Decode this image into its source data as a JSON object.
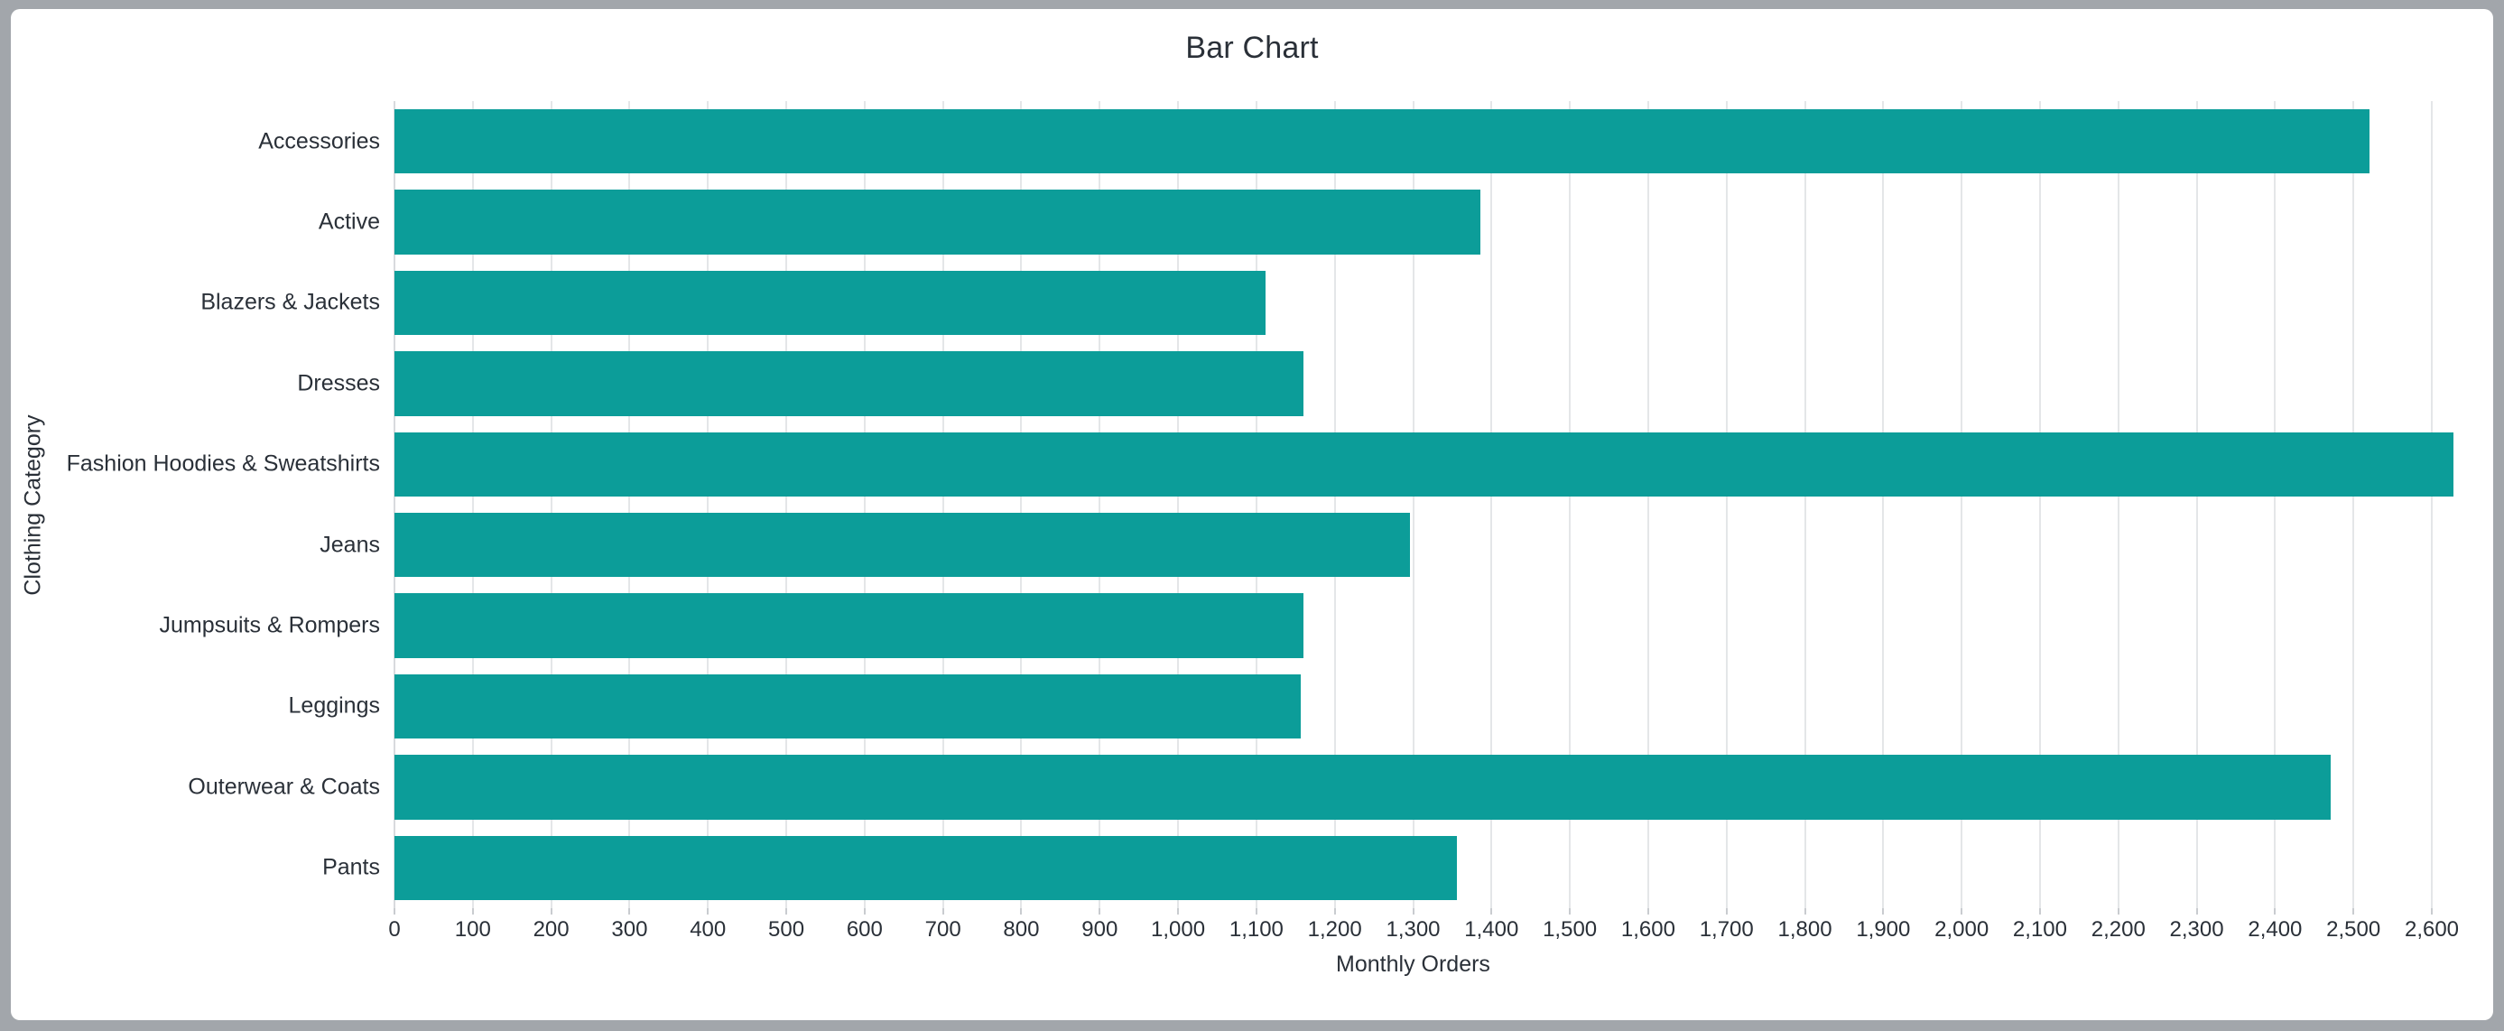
{
  "window": {
    "frame_color": "#a2a6ab",
    "card_background": "#ffffff"
  },
  "chart_data": {
    "type": "bar",
    "orientation": "horizontal",
    "title": "Bar Chart",
    "xlabel": "Monthly Orders",
    "ylabel": "Clothing Category",
    "categories": [
      "Accessories",
      "Active",
      "Blazers & Jackets",
      "Dresses",
      "Fashion Hoodies & Sweatshirts",
      "Jeans",
      "Jumpsuits & Rompers",
      "Leggings",
      "Outerwear & Coats",
      "Pants"
    ],
    "values": [
      2521,
      1386,
      1112,
      1160,
      2628,
      1296,
      1160,
      1157,
      2471,
      1356
    ],
    "series": [
      {
        "name": "Monthly Orders",
        "values": [
          2521,
          1386,
          1112,
          1160,
          2628,
          1296,
          1160,
          1157,
          2471,
          1356
        ]
      }
    ],
    "xlim": [
      0,
      2600
    ],
    "x_tick_values": [
      0,
      100,
      200,
      300,
      400,
      500,
      600,
      700,
      800,
      900,
      1000,
      1100,
      1200,
      1300,
      1400,
      1500,
      1600,
      1700,
      1800,
      1900,
      2000,
      2100,
      2200,
      2300,
      2400,
      2500,
      2600
    ],
    "x_tick_labels": [
      "0",
      "100",
      "200",
      "300",
      "400",
      "500",
      "600",
      "700",
      "800",
      "900",
      "1,000",
      "1,100",
      "1,200",
      "1,300",
      "1,400",
      "1,500",
      "1,600",
      "1,700",
      "1,800",
      "1,900",
      "2,000",
      "2,100",
      "2,200",
      "2,300",
      "2,400",
      "2,500",
      "2,600"
    ],
    "bar_color": "#0c9d99",
    "grid": true,
    "grid_color": "#e4e6e8",
    "legend": null,
    "text_color": "#2a3038"
  }
}
